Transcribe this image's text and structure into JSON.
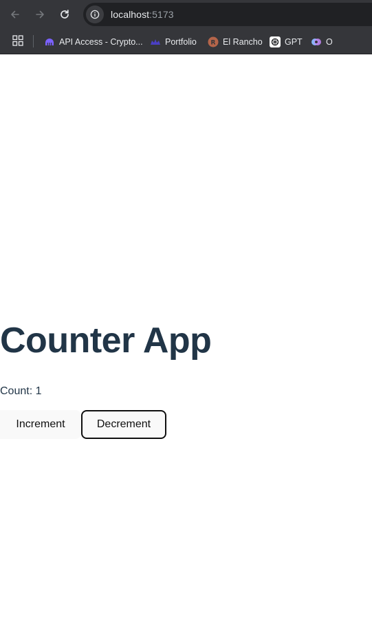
{
  "browser": {
    "url_host": "localhost",
    "url_rest": ":5173",
    "icons": {
      "back": "arrow-left-icon",
      "forward": "arrow-right-icon",
      "reload": "reload-icon",
      "site_info": "info-icon",
      "apps": "apps-grid-icon"
    }
  },
  "bookmarks": [
    {
      "label": "API Access - Crypto...",
      "icon": "kraken-icon",
      "color": "#7b61ff"
    },
    {
      "label": "Portfolio",
      "icon": "portfolio-icon",
      "color": "#4a3fc4"
    },
    {
      "label": "El Rancho",
      "icon": "el-rancho-icon",
      "color": "#b5654a"
    },
    {
      "label": "GPT",
      "icon": "openai-icon",
      "color": "#ffffff"
    },
    {
      "label": "O",
      "icon": "o-icon",
      "color": "#8ab4f8"
    }
  ],
  "app": {
    "title": "Counter App",
    "count_label": "Count: 1",
    "count": 1,
    "increment_label": "Increment",
    "decrement_label": "Decrement",
    "colors": {
      "text": "#213547",
      "button_bg": "#f9f9f9",
      "button_text": "#0f0f0f"
    }
  }
}
